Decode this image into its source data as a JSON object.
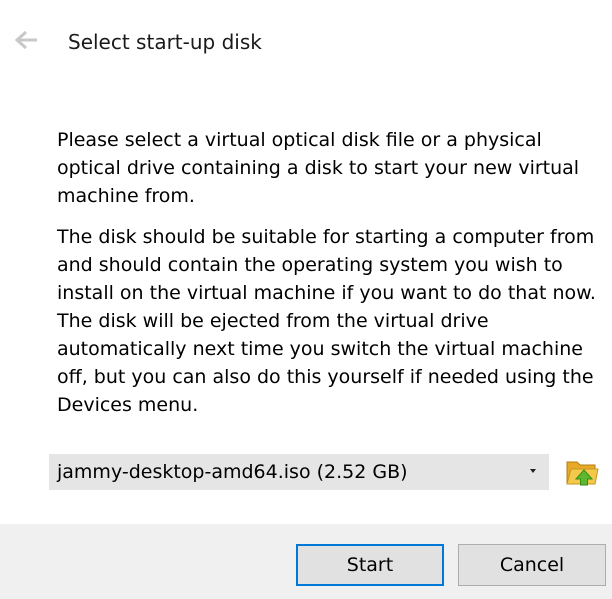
{
  "header": {
    "back_icon": "arrow-left-icon",
    "title": "Select start-up disk"
  },
  "content": {
    "paragraph1": "Please select a virtual optical disk file or a physical optical drive containing a disk to start your new virtual machine from.",
    "paragraph2": "The disk should be suitable for starting a computer from and should contain the operating system you wish to install on the virtual machine if you want to do that now. The disk will be ejected from the virtual drive automatically next time you switch the virtual machine off, but you can also do this yourself if needed using the Devices menu."
  },
  "disk_selector": {
    "selected_value": "jammy-desktop-amd64.iso (2.52 GB)",
    "dropdown_icon": "chevron-down-icon",
    "browse_icon": "folder-open-icon"
  },
  "footer": {
    "start_label": "Start",
    "cancel_label": "Cancel"
  },
  "colors": {
    "accent": "#0078d7",
    "back_arrow": "#c8c8c8",
    "folder_yellow": "#f2c94c",
    "folder_green": "#5cb82e",
    "footer_bg": "#f0f0f0",
    "combo_bg": "#e5e5e5"
  }
}
